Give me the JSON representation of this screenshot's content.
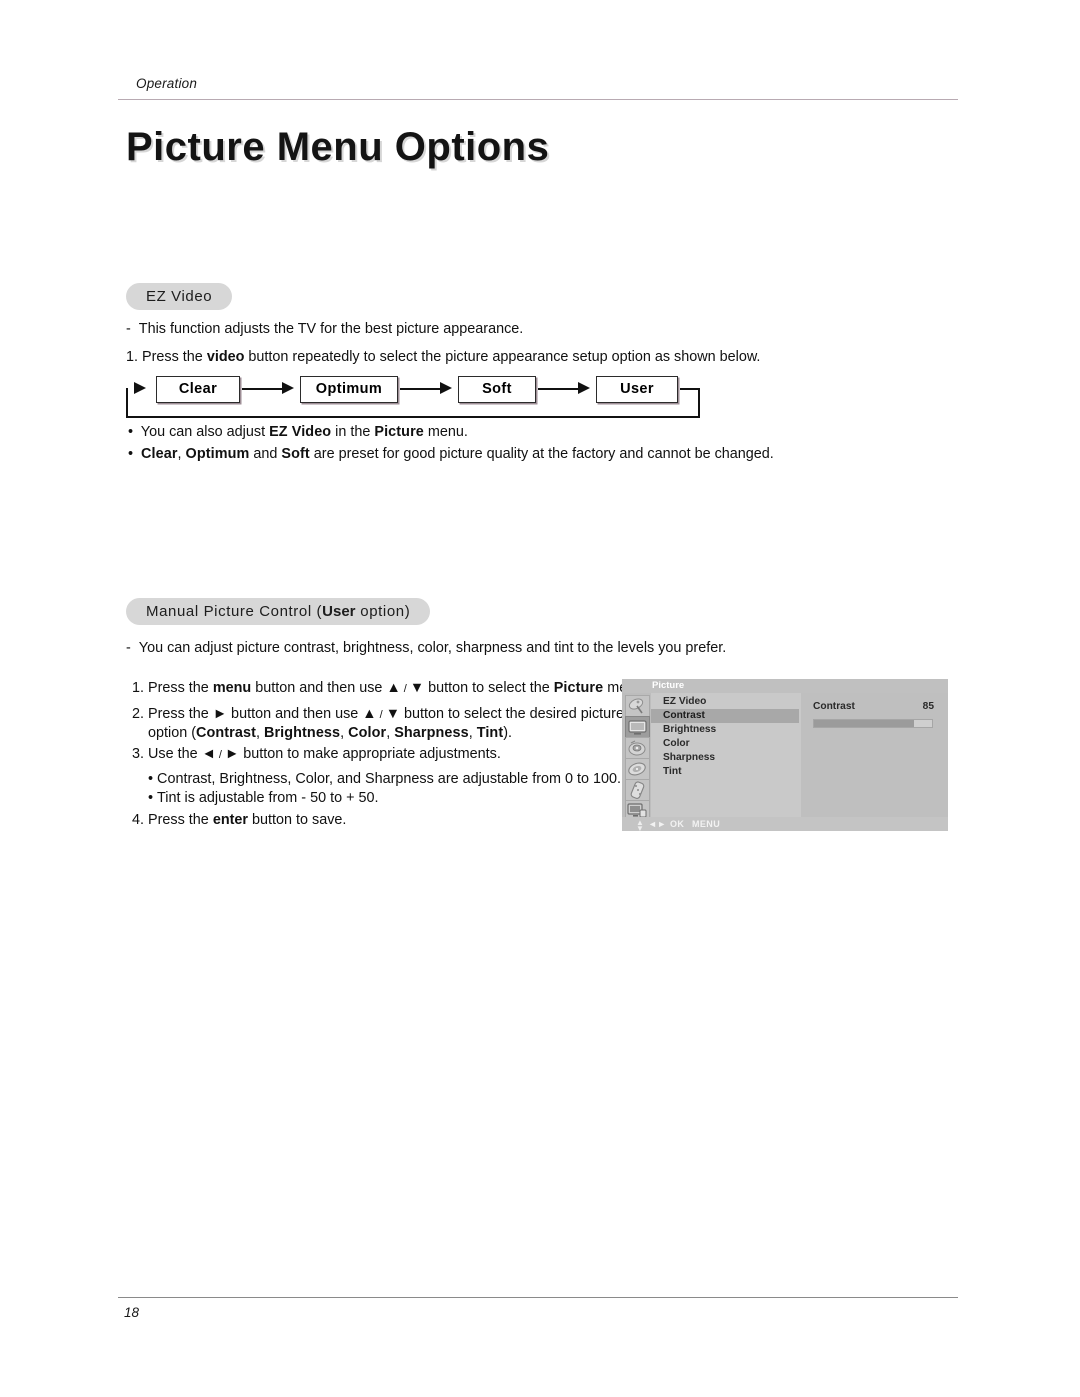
{
  "header": {
    "running_head": "Operation",
    "title": "Picture Menu Options"
  },
  "sections": {
    "ez_video": {
      "pill_label": "EZ Video",
      "dash_note": "This function adjusts the TV for the best picture appearance.",
      "step1": {
        "num": "1.",
        "pre": "Press the",
        "bold": "video",
        "post": "button repeatedly to select the picture appearance setup option as shown below."
      },
      "flow": {
        "boxes": [
          "Clear",
          "Optimum",
          "Soft",
          "User"
        ]
      },
      "bullets": [
        {
          "parts": [
            "You can also adjust ",
            "EZ Video",
            " in the ",
            "Picture",
            " menu."
          ]
        },
        {
          "parts": [
            "Clear",
            ", ",
            "Optimum",
            " and ",
            "Soft",
            " are preset for good picture quality at the factory and cannot be changed."
          ]
        }
      ]
    },
    "manual_picture_control": {
      "pill_prefix": "Manual Picture Control (",
      "pill_bold": "User",
      "pill_suffix": " option)",
      "dash_note": "You can adjust picture contrast, brightness, color, sharpness and tint to the levels you prefer.",
      "steps": [
        {
          "num": "1.",
          "text_a": "Press the ",
          "bold_a": "menu",
          "text_b": " button and then use ",
          "glyph_a": "▲",
          "sep": " / ",
          "glyph_b": "▼",
          "text_c": " button to select the ",
          "bold_b": "Picture",
          "text_d": " menu."
        },
        {
          "num": "2.",
          "text_a": "Press the ",
          "glyph_a": "►",
          "text_b": " button and then use ",
          "glyph_b": "▲",
          "sep": " / ",
          "glyph_c": "▼",
          "text_c": " button to select the desired picture",
          "line2_pre": "option (",
          "line2_options": [
            "Contrast",
            "Brightness",
            "Color",
            "Sharpness",
            "Tint"
          ],
          "line2_post": ")."
        },
        {
          "num": "3.",
          "text_a": "Use the ",
          "glyph_a": "◄",
          "sep": " / ",
          "glyph_b": "►",
          "text_b": " button to make appropriate adjustments."
        },
        {
          "num": "4.",
          "text_a": "Press the ",
          "bold_a": "enter",
          "text_b": " button to save."
        }
      ],
      "range_bullets": [
        "Contrast, Brightness, Color, and Sharpness are adjustable from 0 to 100.",
        "Tint is adjustable from - 50 to + 50."
      ]
    }
  },
  "osd": {
    "title": "Picture",
    "menu_items": [
      {
        "label": "EZ Video",
        "selected": false
      },
      {
        "label": "Contrast",
        "selected": true
      },
      {
        "label": "Brightness",
        "selected": false
      },
      {
        "label": "Color",
        "selected": false
      },
      {
        "label": "Sharpness",
        "selected": false
      },
      {
        "label": "Tint",
        "selected": false
      }
    ],
    "rail_icons": [
      {
        "name": "satellite-dish-icon",
        "selected": false
      },
      {
        "name": "tv-screen-icon",
        "selected": true
      },
      {
        "name": "audio-speaker-icon",
        "selected": false
      },
      {
        "name": "clock-timer-icon",
        "selected": false
      },
      {
        "name": "remote-control-icon",
        "selected": false
      },
      {
        "name": "setup-monitor-icon",
        "selected": false
      }
    ],
    "panel": {
      "label": "Contrast",
      "value": "85",
      "slider_percent": 85
    },
    "footer": {
      "updown_glyph_up": "▲",
      "updown_glyph_down": "▼",
      "leftright_glyph": "◄►",
      "ok_label": "OK",
      "menu_label": "MENU"
    },
    "colors": {
      "background": "#c9c9c9",
      "highlight": "#a8a8a8",
      "title_bar": "#c0c0c0",
      "slider_fill": "#9b9b9b"
    }
  },
  "footer": {
    "page_number": "18"
  }
}
